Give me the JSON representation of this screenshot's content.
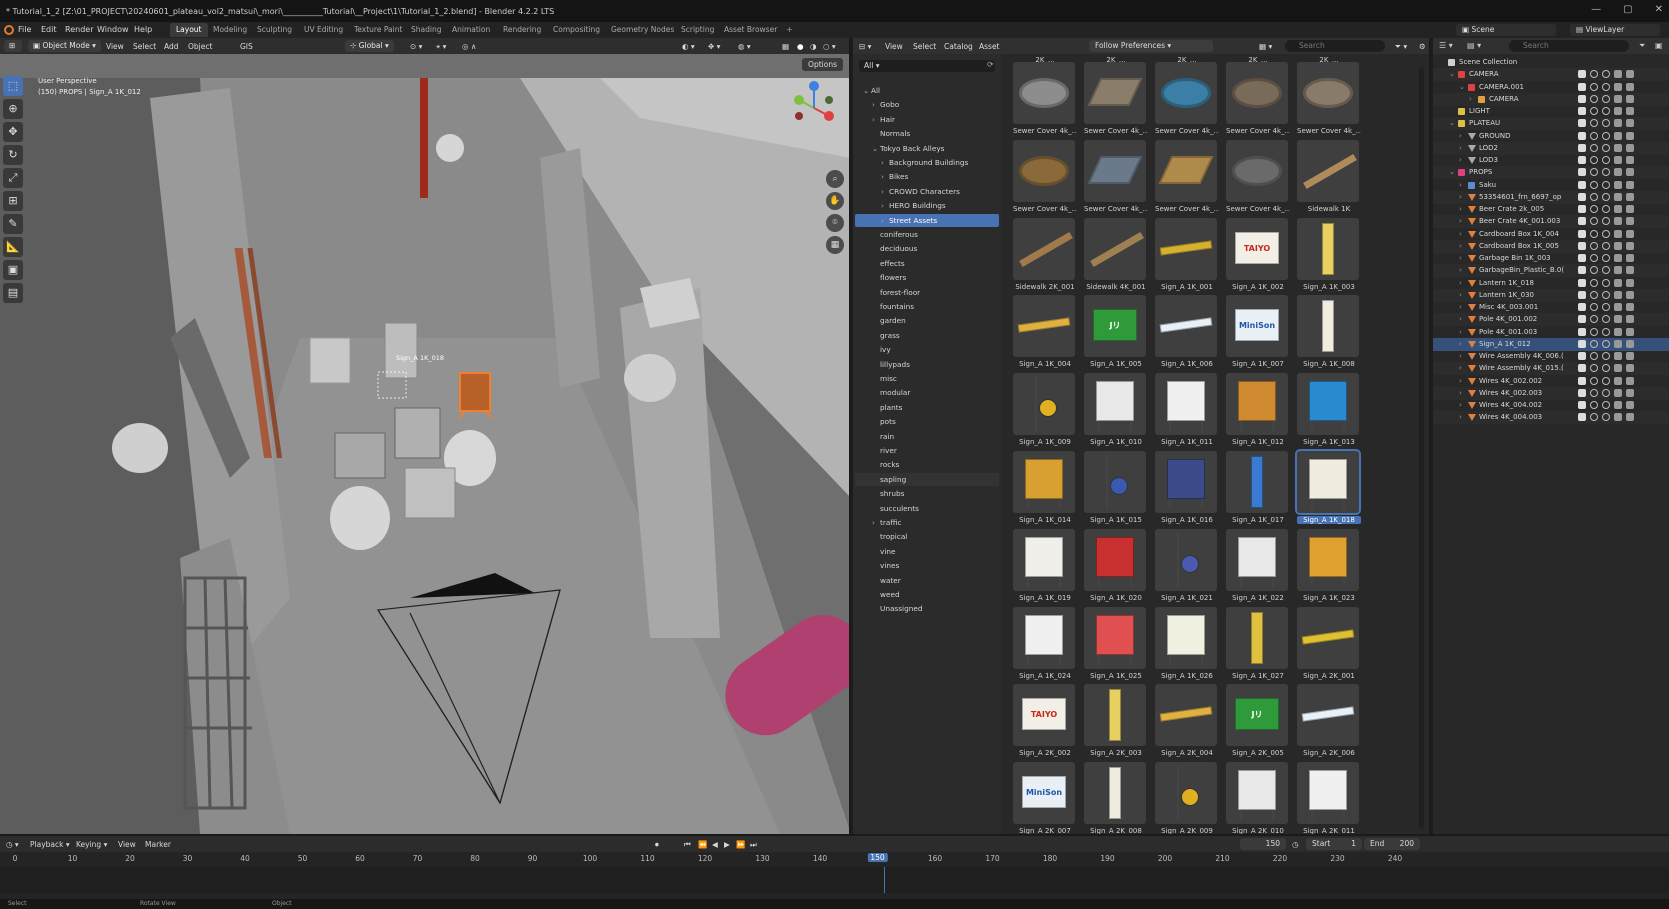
{
  "title": "* Tutorial_1_2 [Z:\\01_PROJECT\\20240601_plateau_vol2_matsui\\_mori\\__________Tutorial\\__Project\\1\\Tutorial_1_2.blend] - Blender 4.2.2 LTS",
  "menu": [
    "File",
    "Edit",
    "Render",
    "Window",
    "Help"
  ],
  "workspaces": [
    "Layout",
    "Modeling",
    "Sculpting",
    "UV Editing",
    "Texture Paint",
    "Shading",
    "Animation",
    "Rendering",
    "Compositing",
    "Geometry Nodes",
    "Scripting",
    "Asset Browser"
  ],
  "active_workspace": "Layout",
  "scene": "Scene",
  "view_layer": "ViewLayer",
  "viewport": {
    "mode": "Object Mode",
    "menus": [
      "View",
      "Select",
      "Add",
      "Object"
    ],
    "gis": "GIS",
    "transform": "Global",
    "info_line1": "User Perspective",
    "info_line2": "(150) PROPS | Sign_A 1K_012",
    "options": "Options",
    "object_label": "Sign_A 1K_018"
  },
  "asset_browser": {
    "menus": [
      "View",
      "Select",
      "Catalog",
      "Asset"
    ],
    "import_method": "Follow Preferences",
    "search_placeholder": "Search",
    "library": "All",
    "catalogs": [
      {
        "label": "All",
        "depth": 0,
        "arrow": "v"
      },
      {
        "label": "Gobo",
        "depth": 1,
        "arrow": ">"
      },
      {
        "label": "Hair",
        "depth": 1,
        "arrow": ">"
      },
      {
        "label": "Normals",
        "depth": 1,
        "arrow": ""
      },
      {
        "label": "Tokyo Back Alleys",
        "depth": 1,
        "arrow": "v"
      },
      {
        "label": "Background Buildings",
        "depth": 2,
        "arrow": ">"
      },
      {
        "label": "Bikes",
        "depth": 2,
        "arrow": ">"
      },
      {
        "label": "CROWD Characters",
        "depth": 2,
        "arrow": ">"
      },
      {
        "label": "HERO Buildings",
        "depth": 2,
        "arrow": ">"
      },
      {
        "label": "Street Assets",
        "depth": 2,
        "arrow": ">",
        "active": true
      },
      {
        "label": "coniferous",
        "depth": 1,
        "arrow": ""
      },
      {
        "label": "deciduous",
        "depth": 1,
        "arrow": ""
      },
      {
        "label": "effects",
        "depth": 1,
        "arrow": ""
      },
      {
        "label": "flowers",
        "depth": 1,
        "arrow": ""
      },
      {
        "label": "forest-floor",
        "depth": 1,
        "arrow": ""
      },
      {
        "label": "fountains",
        "depth": 1,
        "arrow": ""
      },
      {
        "label": "garden",
        "depth": 1,
        "arrow": ""
      },
      {
        "label": "grass",
        "depth": 1,
        "arrow": ""
      },
      {
        "label": "ivy",
        "depth": 1,
        "arrow": ""
      },
      {
        "label": "lillypads",
        "depth": 1,
        "arrow": ""
      },
      {
        "label": "misc",
        "depth": 1,
        "arrow": ""
      },
      {
        "label": "modular",
        "depth": 1,
        "arrow": ""
      },
      {
        "label": "plants",
        "depth": 1,
        "arrow": ""
      },
      {
        "label": "pots",
        "depth": 1,
        "arrow": ""
      },
      {
        "label": "rain",
        "depth": 1,
        "arrow": ""
      },
      {
        "label": "river",
        "depth": 1,
        "arrow": ""
      },
      {
        "label": "rocks",
        "depth": 1,
        "arrow": ""
      },
      {
        "label": "sapling",
        "depth": 1,
        "arrow": "",
        "hover": true
      },
      {
        "label": "shrubs",
        "depth": 1,
        "arrow": ""
      },
      {
        "label": "succulents",
        "depth": 1,
        "arrow": ""
      },
      {
        "label": "traffic",
        "depth": 1,
        "arrow": ">"
      },
      {
        "label": "tropical",
        "depth": 1,
        "arrow": ""
      },
      {
        "label": "vine",
        "depth": 1,
        "arrow": ""
      },
      {
        "label": "vines",
        "depth": 1,
        "arrow": ""
      },
      {
        "label": "water",
        "depth": 1,
        "arrow": ""
      },
      {
        "label": "weed",
        "depth": 1,
        "arrow": ""
      },
      {
        "label": "Unassigned",
        "depth": 1,
        "arrow": ""
      }
    ],
    "top_labels": [
      "Sewer Cover 2K_...",
      "Sewer Cover 2K_...",
      "Sewer Cover 2K_...",
      "Sewer Cover 2K_...",
      "Sewer Cover 2K_..."
    ],
    "assets": [
      {
        "label": "Sewer Cover 4k_...",
        "kind": "manhole",
        "color": "#8d8d8d"
      },
      {
        "label": "Sewer Cover 4k_...",
        "kind": "plate",
        "color": "#8a7d6a"
      },
      {
        "label": "Sewer Cover 4k_...",
        "kind": "manhole",
        "color": "#3b7fa6"
      },
      {
        "label": "Sewer Cover 4k_...",
        "kind": "manhole",
        "color": "#7a6a5a"
      },
      {
        "label": "Sewer Cover 4k_...",
        "kind": "manhole",
        "color": "#8a7a6a"
      },
      {
        "label": "Sewer Cover 4k_...",
        "kind": "manhole",
        "color": "#8a6a3a"
      },
      {
        "label": "Sewer Cover 4k_...",
        "kind": "plate",
        "color": "#6a7a8a"
      },
      {
        "label": "Sewer Cover 4k_...",
        "kind": "plate",
        "color": "#b08a4a"
      },
      {
        "label": "Sewer Cover 4k_...",
        "kind": "manhole",
        "color": "#6a6a6a"
      },
      {
        "label": "Sidewalk 1K",
        "kind": "rail",
        "color": "#b08a5a"
      },
      {
        "label": "Sidewalk 2K_001",
        "kind": "rail",
        "color": "#a07a4a"
      },
      {
        "label": "Sidewalk 4K_001",
        "kind": "rail",
        "color": "#a08050"
      },
      {
        "label": "Sign_A 1K_001",
        "kind": "bar",
        "color": "#d8b030"
      },
      {
        "label": "Sign_A 1K_002",
        "kind": "sign",
        "color": "#f1efe6",
        "text": "TAIYO",
        "textcolor": "#c8281e"
      },
      {
        "label": "Sign_A 1K_003",
        "kind": "tall",
        "color": "#e8d060"
      },
      {
        "label": "Sign_A 1K_004",
        "kind": "bar",
        "color": "#e0b040"
      },
      {
        "label": "Sign_A 1K_005",
        "kind": "sign",
        "color": "#2f9a3a",
        "text": "Jリ",
        "textcolor": "#ffffff"
      },
      {
        "label": "Sign_A 1K_006",
        "kind": "bar",
        "color": "#e8f0f8"
      },
      {
        "label": "Sign_A 1K_007",
        "kind": "sign",
        "color": "#e8f0f6",
        "text": "MiniSon",
        "textcolor": "#2255aa"
      },
      {
        "label": "Sign_A 1K_008",
        "kind": "tall",
        "color": "#f0ece0"
      },
      {
        "label": "Sign_A 1K_009",
        "kind": "pole",
        "color": "#e0b020"
      },
      {
        "label": "Sign_A 1K_010",
        "kind": "board",
        "color": "#e8e8e8"
      },
      {
        "label": "Sign_A 1K_011",
        "kind": "board",
        "color": "#f0f0f0"
      },
      {
        "label": "Sign_A 1K_012",
        "kind": "board",
        "color": "#d08a30"
      },
      {
        "label": "Sign_A 1K_013",
        "kind": "board",
        "color": "#2a8ad0"
      },
      {
        "label": "Sign_A 1K_014",
        "kind": "board",
        "color": "#d8a030"
      },
      {
        "label": "Sign_A 1K_015",
        "kind": "pole",
        "color": "#3a5ab0"
      },
      {
        "label": "Sign_A 1K_016",
        "kind": "board",
        "color": "#3a4a8a"
      },
      {
        "label": "Sign_A 1K_017",
        "kind": "tall",
        "color": "#3a7ad0"
      },
      {
        "label": "Sign_A 1K_018",
        "kind": "board",
        "color": "#f0ece0",
        "selected": true
      },
      {
        "label": "Sign_A 1K_019",
        "kind": "board",
        "color": "#f0eee8"
      },
      {
        "label": "Sign_A 1K_020",
        "kind": "board",
        "color": "#c83030"
      },
      {
        "label": "Sign_A 1K_021",
        "kind": "pole",
        "color": "#4a5ab0"
      },
      {
        "label": "Sign_A 1K_022",
        "kind": "board",
        "color": "#e8e8e8"
      },
      {
        "label": "Sign_A 1K_023",
        "kind": "board",
        "color": "#e0a030"
      },
      {
        "label": "Sign_A 1K_024",
        "kind": "board",
        "color": "#f0f0f0"
      },
      {
        "label": "Sign_A 1K_025",
        "kind": "board",
        "color": "#e05050"
      },
      {
        "label": "Sign_A 1K_026",
        "kind": "board",
        "color": "#f0f0e0"
      },
      {
        "label": "Sign_A 1K_027",
        "kind": "tall",
        "color": "#e0c040"
      },
      {
        "label": "Sign_A 2K_001",
        "kind": "bar",
        "color": "#e0c030"
      },
      {
        "label": "Sign_A 2K_002",
        "kind": "sign",
        "color": "#f1efe6",
        "text": "TAIYO",
        "textcolor": "#c8281e"
      },
      {
        "label": "Sign_A 2K_003",
        "kind": "tall",
        "color": "#e8d060"
      },
      {
        "label": "Sign_A 2K_004",
        "kind": "bar",
        "color": "#e0b040"
      },
      {
        "label": "Sign_A 2K_005",
        "kind": "sign",
        "color": "#2f9a3a",
        "text": "Jリ",
        "textcolor": "#ffffff"
      },
      {
        "label": "Sign_A 2K_006",
        "kind": "bar",
        "color": "#e8f0f8"
      },
      {
        "label": "Sign_A 2K_007",
        "kind": "sign",
        "color": "#e8f0f6",
        "text": "MiniSon",
        "textcolor": "#2255aa"
      },
      {
        "label": "Sign_A 2K_008",
        "kind": "tall",
        "color": "#f0ece0"
      },
      {
        "label": "Sign_A 2K_009",
        "kind": "pole",
        "color": "#e0b020"
      },
      {
        "label": "Sign_A 2K_010",
        "kind": "board",
        "color": "#e8e8e8"
      },
      {
        "label": "Sign_A 2K_011",
        "kind": "board",
        "color": "#f0f0f0"
      }
    ]
  },
  "outliner": {
    "search_placeholder": "Search",
    "rows": [
      {
        "label": "Scene Collection",
        "depth": 0,
        "icon": "collection",
        "color": "#cfcfcf"
      },
      {
        "label": "CAMERA",
        "depth": 1,
        "icon": "collection",
        "color": "#e04040",
        "tri": "v"
      },
      {
        "label": "CAMERA.001",
        "depth": 2,
        "icon": "object",
        "color": "#e04040",
        "tri": "v"
      },
      {
        "label": "CAMERA",
        "depth": 3,
        "icon": "camera",
        "color": "#e0a040",
        "tri": ">"
      },
      {
        "label": "LIGHT",
        "depth": 1,
        "icon": "collection",
        "color": "#e0c040",
        "tri": ""
      },
      {
        "label": "PLATEAU",
        "depth": 1,
        "icon": "collection",
        "color": "#e0c040",
        "tri": "v"
      },
      {
        "label": "GROUND",
        "depth": 2,
        "icon": "mesh",
        "color": "#aaaaaa",
        "tri": ">"
      },
      {
        "label": "LOD2",
        "depth": 2,
        "icon": "mesh",
        "color": "#aaaaaa",
        "tri": ">"
      },
      {
        "label": "LOD3",
        "depth": 2,
        "icon": "mesh",
        "color": "#aaaaaa",
        "tri": ">"
      },
      {
        "label": "PROPS",
        "depth": 1,
        "icon": "collection",
        "color": "#e04080",
        "tri": "v"
      },
      {
        "label": "Saku",
        "depth": 2,
        "icon": "collection",
        "color": "#5a8ad0",
        "tri": ">"
      },
      {
        "label": "53354601_frn_6697_op",
        "depth": 2,
        "icon": "mesh",
        "color": "#e08040",
        "tri": ">"
      },
      {
        "label": "Beer Crate 2k_005",
        "depth": 2,
        "icon": "mesh",
        "color": "#e08040",
        "tri": ">"
      },
      {
        "label": "Beer Crate 4K_001.003",
        "depth": 2,
        "icon": "mesh",
        "color": "#e08040",
        "tri": ">"
      },
      {
        "label": "Cardboard Box 1K_004",
        "depth": 2,
        "icon": "mesh",
        "color": "#e08040",
        "tri": ">"
      },
      {
        "label": "Cardboard Box 1K_005",
        "depth": 2,
        "icon": "mesh",
        "color": "#e08040",
        "tri": ">"
      },
      {
        "label": "Garbage Bin 1K_003",
        "depth": 2,
        "icon": "mesh",
        "color": "#e08040",
        "tri": ">"
      },
      {
        "label": "GarbageBin_Plastic_B.0(",
        "depth": 2,
        "icon": "mesh",
        "color": "#e08040",
        "tri": ">"
      },
      {
        "label": "Lantern 1K_018",
        "depth": 2,
        "icon": "mesh",
        "color": "#e08040",
        "tri": ">"
      },
      {
        "label": "Lantern 1K_030",
        "depth": 2,
        "icon": "mesh",
        "color": "#e08040",
        "tri": ">"
      },
      {
        "label": "Misc 4K_003.001",
        "depth": 2,
        "icon": "mesh",
        "color": "#e08040",
        "tri": ">"
      },
      {
        "label": "Pole 4K_001.002",
        "depth": 2,
        "icon": "mesh",
        "color": "#e08040",
        "tri": ">"
      },
      {
        "label": "Pole 4K_001.003",
        "depth": 2,
        "icon": "mesh",
        "color": "#e08040",
        "tri": ">"
      },
      {
        "label": "Sign_A 1K_012",
        "depth": 2,
        "icon": "mesh",
        "color": "#e08040",
        "tri": ">",
        "selected": true
      },
      {
        "label": "Wire Assembly 4K_006.(",
        "depth": 2,
        "icon": "mesh",
        "color": "#e08040",
        "tri": ">"
      },
      {
        "label": "Wire Assembly 4K_015.(",
        "depth": 2,
        "icon": "mesh",
        "color": "#e08040",
        "tri": ">"
      },
      {
        "label": "Wires 4K_002.002",
        "depth": 2,
        "icon": "mesh",
        "color": "#e08040",
        "tri": ">"
      },
      {
        "label": "Wires 4K_002.003",
        "depth": 2,
        "icon": "mesh",
        "color": "#e08040",
        "tri": ">"
      },
      {
        "label": "Wires 4K_004.002",
        "depth": 2,
        "icon": "mesh",
        "color": "#e08040",
        "tri": ">"
      },
      {
        "label": "Wires 4K_004.003",
        "depth": 2,
        "icon": "mesh",
        "color": "#e08040",
        "tri": ">"
      }
    ]
  },
  "timeline": {
    "menus": [
      "Playback",
      "Keying",
      "View",
      "Marker"
    ],
    "current_frame": "150",
    "start_label": "Start",
    "start": "1",
    "end_label": "End",
    "end": "200",
    "ticks": [
      "0",
      "10",
      "20",
      "30",
      "40",
      "50",
      "60",
      "70",
      "80",
      "90",
      "100",
      "110",
      "120",
      "130",
      "140",
      "150",
      "160",
      "170",
      "180",
      "190",
      "200",
      "210",
      "220",
      "230",
      "240"
    ]
  },
  "statusbar": [
    "Select",
    "Rotate View",
    "Object"
  ]
}
